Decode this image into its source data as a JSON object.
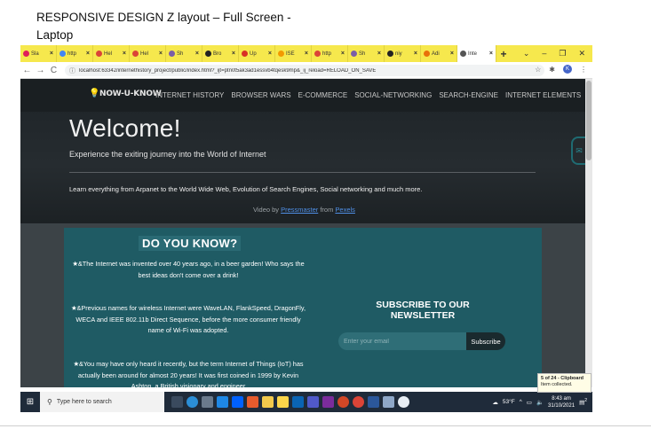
{
  "doc": {
    "title_line1": "RESPONSIVE DESIGN Z layout  – Full Screen -",
    "title_line2": "Laptop"
  },
  "browser": {
    "tabs": [
      {
        "label": "Sla",
        "icon": "slack-icon",
        "color": "#e01e5a"
      },
      {
        "label": "http",
        "icon": "google-icon",
        "color": "#4285f4"
      },
      {
        "label": "Hel",
        "icon": "chrome-icon",
        "color": "#db4437"
      },
      {
        "label": "Hel",
        "icon": "chrome-icon",
        "color": "#db4437"
      },
      {
        "label": "Sh",
        "icon": "puzzle-icon",
        "color": "#7b5ea7"
      },
      {
        "label": "Bro",
        "icon": "github-icon",
        "color": "#222222"
      },
      {
        "label": "Up",
        "icon": "gmail-icon",
        "color": "#d93025"
      },
      {
        "label": "ISE",
        "icon": "doc-icon",
        "color": "#f29900"
      },
      {
        "label": "http",
        "icon": "chrome-icon",
        "color": "#db4437"
      },
      {
        "label": "Sh",
        "icon": "puzzle-icon",
        "color": "#7b5ea7"
      },
      {
        "label": "niy",
        "icon": "github-icon",
        "color": "#222222"
      },
      {
        "label": "Adi",
        "icon": "circle-icon",
        "color": "#e8710a"
      },
      {
        "label": "Inte",
        "icon": "globe-icon",
        "color": "#555555",
        "active": true
      }
    ],
    "new_tab": "+",
    "window_controls": {
      "dropdown": "⌄",
      "minimize": "–",
      "restore": "❐",
      "close": "✕"
    },
    "nav": {
      "back": "←",
      "forward": "→",
      "reload": "C"
    },
    "url": "localhost:63342/internethistory_project/public/index.html?_ijt=ptn0t5ak3ad1essvb4tqesk9mp&_ij_reload=RELOAD_ON_SAVE",
    "profile_initial": "K"
  },
  "site": {
    "logo": "NOW-U-KNOW",
    "nav": [
      "INTERNET HISTORY",
      "BROWSER WARS",
      "E-COMMERCE",
      "SOCIAL-NETWORKING",
      "SEARCH-ENGINE",
      "INTERNET ELEMENTS"
    ],
    "hero": {
      "heading": "Welcome!",
      "tagline": "Experience the exiting journey into the World of Internet",
      "intro": "Learn everything from Arpanet to the World Wide Web, Evolution of Search Engines, Social networking and much more.",
      "credit_prefix": "Video by ",
      "credit_author": "Pressmaster",
      "credit_mid": " from ",
      "credit_source": "Pexels"
    },
    "did_you_know": {
      "title": "DO YOU KNOW?",
      "facts": [
        "★&The Internet was invented over 40 years ago, in a beer garden! Who says the best ideas don't come over a drink!",
        "★&Previous names for wireless Internet were WaveLAN, FlankSpeed, DragonFly, WECA and IEEE 802.11b Direct Sequence, before the more consumer friendly name of Wi-Fi was adopted.",
        "★&You may have only heard it recently, but the term Internet of Things (IoT) has actually been around for almost 20 years! It was first coined in 1999 by Kevin Ashton, a British visionary and engineer"
      ]
    },
    "newsletter": {
      "title": "SUBSCRIBE TO OUR NEWSLETTER",
      "placeholder": "Enter your email",
      "button": "Subscribe"
    }
  },
  "taskbar": {
    "search_placeholder": "Type here to search",
    "weather": "53°F",
    "time": "8:43 am",
    "date": "31/10/2021",
    "notification_count": "2"
  },
  "clipboard_toast": {
    "title": "5 of 24 - Clipboard",
    "body": "Item collected."
  }
}
